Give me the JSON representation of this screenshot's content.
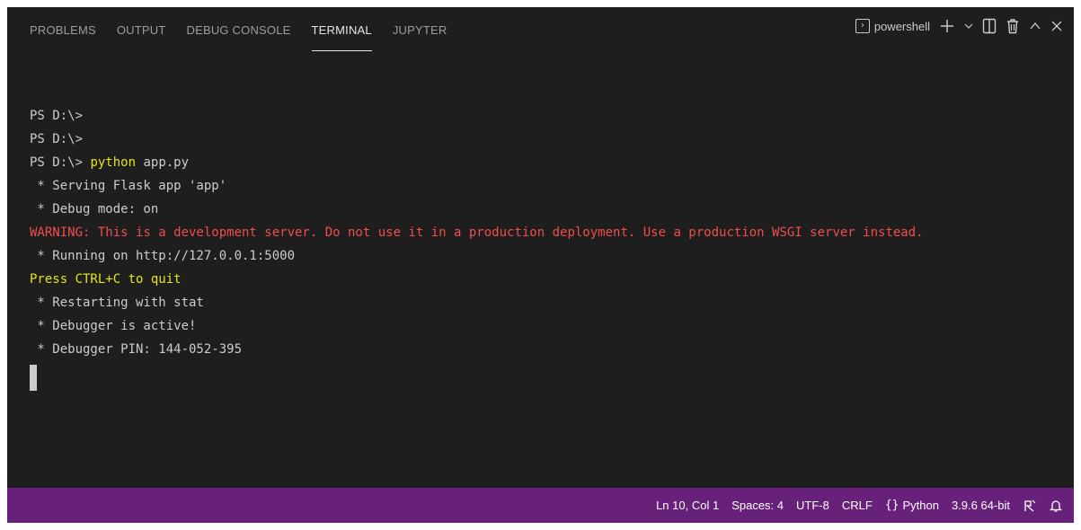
{
  "tabs": [
    {
      "label": "PROBLEMS"
    },
    {
      "label": "OUTPUT"
    },
    {
      "label": "DEBUG CONSOLE"
    },
    {
      "label": "TERMINAL"
    },
    {
      "label": "JUPYTER"
    }
  ],
  "active_tab": "TERMINAL",
  "toolbar": {
    "shell_label": "powershell"
  },
  "terminal": {
    "lines": [
      {
        "prompt": "PS D:\\>",
        "cmd": "",
        "args": ""
      },
      {
        "prompt": "PS D:\\>",
        "cmd": "",
        "args": ""
      },
      {
        "prompt": "PS D:\\>",
        "cmd": "python",
        "args": " app.py"
      },
      {
        "text": " * Serving Flask app 'app'"
      },
      {
        "text": " * Debug mode: on"
      },
      {
        "text": "WARNING: This is a development server. Do not use it in a production deployment. Use a production WSGI server instead."
      },
      {
        "text": " * Running on http://127.0.0.1:5000"
      },
      {
        "text": "Press CTRL+C to quit"
      },
      {
        "text": " * Restarting with stat"
      },
      {
        "text": " * Debugger is active!"
      },
      {
        "text": " * Debugger PIN: 144-052-395"
      }
    ]
  },
  "statusbar": {
    "position": "Ln 10, Col 1",
    "spaces": "Spaces: 4",
    "encoding": "UTF-8",
    "eol": "CRLF",
    "language": "Python",
    "interpreter": "3.9.6 64-bit"
  },
  "colors": {
    "background": "#1e1e1e",
    "statusbar": "#68217a",
    "warning": "#f14c4c",
    "highlight": "#e5e510"
  }
}
